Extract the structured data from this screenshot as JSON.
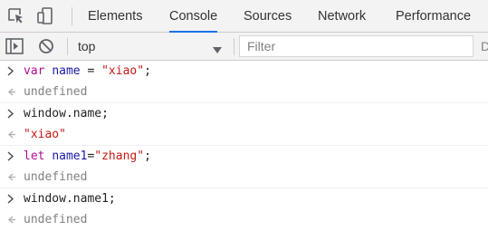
{
  "devtools": {
    "tabs": [
      {
        "label": "Elements",
        "active": false
      },
      {
        "label": "Console",
        "active": true
      },
      {
        "label": "Sources",
        "active": false
      },
      {
        "label": "Network",
        "active": false
      },
      {
        "label": "Performance",
        "active": false
      }
    ],
    "icons": {
      "inspect": "inspect-element-icon",
      "device": "device-toolbar-icon",
      "sidebar": "console-sidebar-icon",
      "clear": "clear-console-icon",
      "context_dropdown": "chevron-down-icon"
    }
  },
  "toolbar": {
    "context": "top",
    "filter_placeholder": "Filter",
    "filter_value": "",
    "truncated_label": "D"
  },
  "console": {
    "entries": [
      {
        "type": "input",
        "parts": [
          {
            "t": "var",
            "cls": "kw"
          },
          {
            "t": " ",
            "cls": "plain"
          },
          {
            "t": "name",
            "cls": "var"
          },
          {
            "t": " = ",
            "cls": "plain"
          },
          {
            "t": "\"xiao\"",
            "cls": "str"
          },
          {
            "t": ";",
            "cls": "plain"
          }
        ]
      },
      {
        "type": "output",
        "text": "undefined"
      },
      {
        "type": "input",
        "parts": [
          {
            "t": "window.name;",
            "cls": "plain"
          }
        ]
      },
      {
        "type": "output-string",
        "parts": [
          {
            "t": "\"xiao\"",
            "cls": "str"
          }
        ]
      },
      {
        "type": "input",
        "parts": [
          {
            "t": "let",
            "cls": "kw"
          },
          {
            "t": " ",
            "cls": "plain"
          },
          {
            "t": "name1",
            "cls": "var"
          },
          {
            "t": "=",
            "cls": "plain"
          },
          {
            "t": "\"zhang\"",
            "cls": "str"
          },
          {
            "t": ";",
            "cls": "plain"
          }
        ]
      },
      {
        "type": "output",
        "text": "undefined"
      },
      {
        "type": "input",
        "parts": [
          {
            "t": "window.name1;",
            "cls": "plain"
          }
        ]
      },
      {
        "type": "output",
        "text": "undefined"
      }
    ]
  },
  "colors": {
    "active_tab_underline": "#1a73e8",
    "keyword": "#aa0d91",
    "variable": "#1a1aa6",
    "string": "#c41a16",
    "muted": "#808080"
  }
}
